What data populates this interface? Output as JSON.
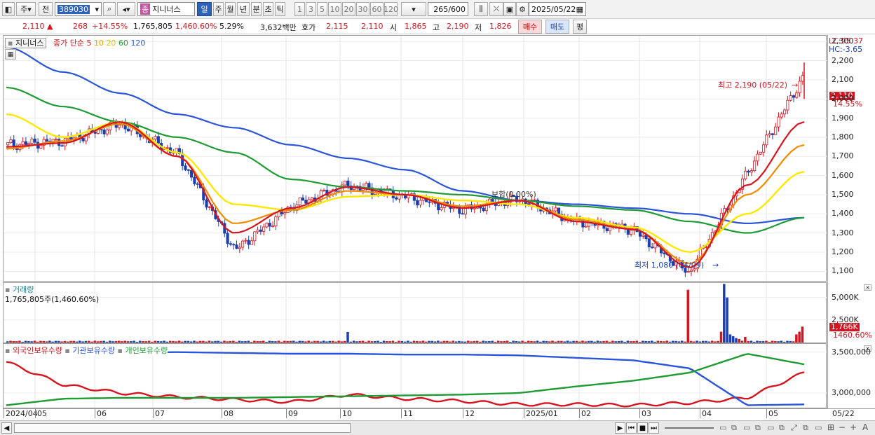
{
  "toolbar": {
    "mode_label": "주",
    "prev_label": "전",
    "ticker": "389030",
    "stock_name": "지니너스",
    "period_buttons": [
      "일",
      "주",
      "월",
      "년",
      "분",
      "초",
      "틱"
    ],
    "period_selected": "일",
    "minute_buttons": [
      "1",
      "3",
      "5",
      "10",
      "20",
      "30",
      "60",
      "120"
    ],
    "count": "265/600",
    "date": "2025/05/22"
  },
  "quote": {
    "price": "2,110",
    "arrow": "▲",
    "change": "268",
    "change_pct": "+14.55%",
    "volume": "1,765,805",
    "volume_pct": "1,460.60%",
    "turnover": "5.29%",
    "amount": "3,632백만",
    "ask_label": "호가",
    "ask1": "2,115",
    "ask2": "2,110",
    "open_label": "시",
    "open": "1,865",
    "high_label": "고",
    "high": "2,190",
    "low_label": "저",
    "low": "1,826",
    "buy_label": "매수",
    "sell_label": "매도",
    "eval_label": "평"
  },
  "price_panel": {
    "name": "지니너스",
    "ma_label": "종가 단순",
    "ma_periods": [
      "5",
      "10",
      "20",
      "60",
      "120"
    ],
    "lc": "LC:95.37",
    "hc": "HC:-3.65",
    "ticks": [
      "2,300",
      "2,200",
      "2,100",
      "2,000",
      "1,900",
      "1,800",
      "1,700",
      "1,600",
      "1,500",
      "1,400",
      "1,300",
      "1,200",
      "1,100"
    ],
    "last_price_tag": "2,110",
    "last_pct_tag": "14.55%",
    "high_annot": "최고 2,190 (05/22)",
    "low_annot": "최저 1,080 (04/09)",
    "mid_annot": "보합(0.00%)"
  },
  "volume_panel": {
    "title": "거래량",
    "value": "1,765,805주(1,460.60%)",
    "ticks": [
      "5,000K",
      "2,500K"
    ],
    "last_tag": "1,766K",
    "last_pct": "1460.60%"
  },
  "holding_panel": {
    "legend": [
      "외국인보유수량",
      "기관보유수량",
      "개인보유수량"
    ],
    "ticks": [
      "3,500,000",
      "3,000,000"
    ]
  },
  "date_axis": [
    "2024/04",
    "05",
    "06",
    "07",
    "08",
    "09",
    "10",
    "11",
    "12",
    "2025/01",
    "02",
    "03",
    "04",
    "05"
  ],
  "date_end": "05/22",
  "colors": {
    "up": "#d5141f",
    "down": "#1b3fb0",
    "ma5": "#d5141f",
    "ma10": "#f08c00",
    "ma20": "#ffe800",
    "ma60": "#1f9b34",
    "ma120": "#2b55d8"
  },
  "chart_data": [
    {
      "type": "line",
      "title": "지니너스",
      "x_dates": [
        "2024/04",
        "05",
        "06",
        "07",
        "08",
        "09",
        "10",
        "11",
        "12",
        "2025/01",
        "02",
        "03",
        "04",
        "05",
        "05/22"
      ],
      "price_close": [
        1760,
        1780,
        1870,
        1710,
        1210,
        1440,
        1550,
        1490,
        1420,
        1480,
        1360,
        1320,
        1090,
        1600,
        2110
      ],
      "ma": {
        "5": [
          1750,
          1770,
          1880,
          1700,
          1300,
          1430,
          1540,
          1500,
          1430,
          1470,
          1360,
          1320,
          1120,
          1550,
          1880
        ],
        "10": [
          1740,
          1780,
          1870,
          1700,
          1350,
          1420,
          1520,
          1500,
          1440,
          1470,
          1370,
          1320,
          1140,
          1500,
          1760
        ],
        "20": [
          1920,
          1800,
          1880,
          1720,
          1450,
          1420,
          1490,
          1500,
          1470,
          1450,
          1380,
          1330,
          1200,
          1400,
          1620
        ],
        "60": [
          2060,
          1960,
          1880,
          1800,
          1720,
          1580,
          1540,
          1520,
          1500,
          1470,
          1440,
          1420,
          1360,
          1300,
          1380
        ],
        "120": [
          2270,
          2140,
          2030,
          1920,
          1850,
          1760,
          1690,
          1630,
          1520,
          1470,
          1450,
          1430,
          1400,
          1350,
          1380
        ]
      },
      "ylim": [
        1050,
        2330
      ],
      "series": [
        {
          "name": "5",
          "values": [
            1750,
            1770,
            1880,
            1700,
            1300,
            1430,
            1540,
            1500,
            1430,
            1470,
            1360,
            1320,
            1120,
            1550,
            1880
          ]
        },
        {
          "name": "10",
          "values": [
            1740,
            1780,
            1870,
            1700,
            1350,
            1420,
            1520,
            1500,
            1440,
            1470,
            1370,
            1320,
            1140,
            1500,
            1760
          ]
        },
        {
          "name": "20",
          "values": [
            1920,
            1800,
            1880,
            1720,
            1450,
            1420,
            1490,
            1500,
            1470,
            1450,
            1380,
            1330,
            1200,
            1400,
            1620
          ]
        },
        {
          "name": "60",
          "values": [
            2060,
            1960,
            1880,
            1800,
            1720,
            1580,
            1540,
            1520,
            1500,
            1470,
            1440,
            1420,
            1360,
            1300,
            1380
          ]
        },
        {
          "name": "120",
          "values": [
            2270,
            2140,
            2030,
            1920,
            1850,
            1760,
            1690,
            1630,
            1520,
            1470,
            1450,
            1430,
            1400,
            1350,
            1380
          ]
        }
      ]
    },
    {
      "type": "bar",
      "title": "거래량",
      "categories": [
        "2024/04",
        "05",
        "06",
        "07",
        "08",
        "09",
        "10",
        "11",
        "12",
        "2025/01",
        "02",
        "03",
        "04",
        "05",
        "05/22"
      ],
      "values": [
        150,
        180,
        160,
        140,
        250,
        200,
        1300,
        120,
        140,
        130,
        110,
        100,
        6500,
        700,
        1766
      ],
      "unit": "K",
      "ylim": [
        0,
        6600
      ]
    },
    {
      "type": "line",
      "title": "보유수량",
      "categories": [
        "2024/04",
        "05",
        "06",
        "07",
        "08",
        "09",
        "10",
        "11",
        "12",
        "2025/01",
        "02",
        "03",
        "04",
        "05",
        "05/22"
      ],
      "series": [
        {
          "name": "외국인보유수량",
          "values": [
            3380000,
            3100000,
            3000000,
            2950000,
            2920000,
            2890000,
            2980000,
            2930000,
            2900000,
            2860000,
            2860000,
            2850000,
            2880000,
            2940000,
            3250000
          ]
        },
        {
          "name": "기관보유수량",
          "values": [
            3480000,
            3480000,
            3490000,
            3500000,
            3490000,
            3480000,
            3480000,
            3470000,
            3470000,
            3460000,
            3430000,
            3400000,
            3300000,
            2850000,
            2860000
          ]
        },
        {
          "name": "개인보유수량",
          "values": [
            2850000,
            2930000,
            2940000,
            2940000,
            2940000,
            2950000,
            2960000,
            2970000,
            2980000,
            3000000,
            3080000,
            3150000,
            3250000,
            3480000,
            3350000
          ]
        }
      ],
      "ylim": [
        2820000,
        3600000
      ]
    }
  ]
}
